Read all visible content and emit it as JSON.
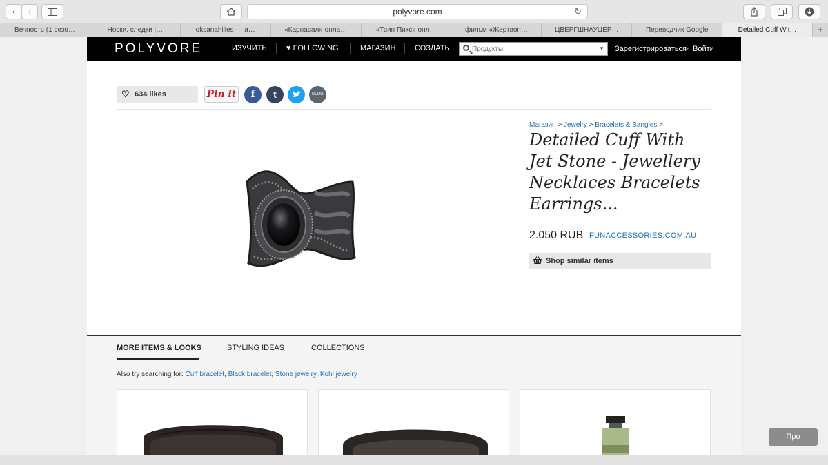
{
  "browser": {
    "url": "polyvore.com",
    "tabs": [
      {
        "label": "Вечность (1 сезо…"
      },
      {
        "label": "Носки, следки |…"
      },
      {
        "label": "oksanahilles — a…"
      },
      {
        "label": "«Карнавал» онла…"
      },
      {
        "label": "«Твин Пикс» онл…"
      },
      {
        "label": "фильм «Жертвоп…"
      },
      {
        "label": "ЦВЕРГШНАУЦЕР…"
      },
      {
        "label": "Переводчик Google"
      },
      {
        "label": "Detailed Cuff Wit…"
      }
    ],
    "new_tab": "+"
  },
  "nav": {
    "logo": "POLYVORE",
    "explore": "ИЗУЧИТЬ",
    "following": "FOLLOWING",
    "shop": "МАГАЗИН",
    "create": "СОЗДАТЬ",
    "search_placeholder": "Продукты:",
    "register": "Зарегистрироваться",
    "dot": "·",
    "login": "Войти"
  },
  "share": {
    "likes": "634 likes",
    "pinit": "Pin it",
    "facebook": "f",
    "tumblr": "t",
    "twitter": "✓",
    "blog": "BLOG"
  },
  "product": {
    "breadcrumb": [
      "Магазин",
      "Jewelry",
      "Bracelets & Bangles"
    ],
    "sep": ">",
    "title": "Detailed Cuff With Jet Stone - Jewellery Necklaces Bracelets Earrings...",
    "price": "2.050 RUB",
    "store": "FUNACCESSORIES.COM.AU",
    "shop_similar": "Shop similar items"
  },
  "section": {
    "tabs": [
      "MORE ITEMS & LOOKS",
      "STYLING IDEAS",
      "COLLECTIONS"
    ],
    "also_label": "Also try searching for:",
    "also_links": [
      "Cuff bracelet",
      "Black bracelet",
      "Stone jewelry",
      "Kohl jewelry"
    ],
    "comma": ","
  },
  "floating": {
    "pro": "Про"
  },
  "colors": {
    "link": "#1f6fb6",
    "facebook": "#3b5998",
    "tumblr": "#35465c",
    "twitter": "#1da1f2",
    "blog": "#5a6670"
  }
}
